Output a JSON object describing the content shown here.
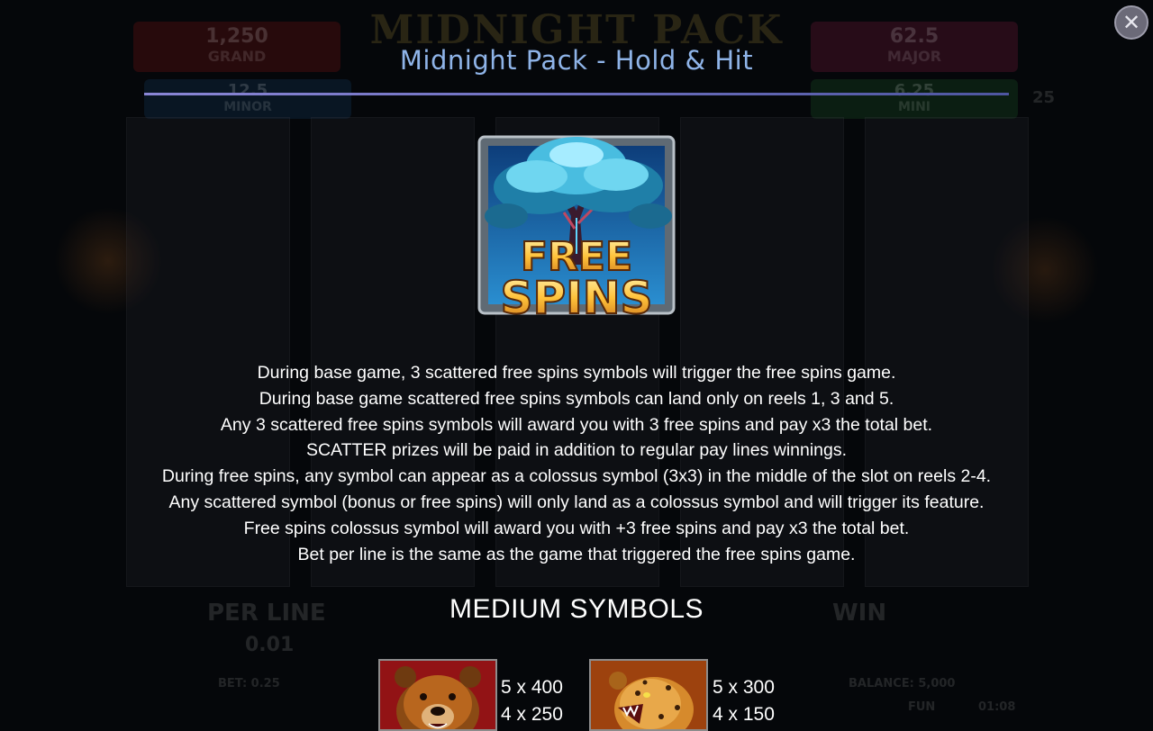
{
  "dialog": {
    "title": "Midnight Pack - Hold & Hit",
    "close_icon": "close-icon"
  },
  "feature_symbol": {
    "icon": "free-spins-symbol",
    "line1": "FREE",
    "line2": "SPINS"
  },
  "description": [
    "During base game, 3 scattered free spins symbols will trigger the free spins game.",
    "During base game scattered free spins symbols can land only on reels 1, 3 and 5.",
    "Any 3 scattered free spins symbols will award you with 3 free spins and pay x3 the total bet.",
    "SCATTER prizes will be paid in addition to regular pay lines winnings.",
    "During free spins, any symbol can appear as a colossus symbol (3x3) in the middle of the slot on reels 2-4.",
    "Any scattered symbol (bonus or free spins) will only land as a colossus symbol and will trigger its feature.",
    "Free spins colossus symbol will award you with +3 free spins and pay x3 the total bet.",
    "Bet per line is the same as the game that triggered the free spins game."
  ],
  "medium_symbols": {
    "heading": "MEDIUM SYMBOLS",
    "items": [
      {
        "icon": "bear-icon",
        "pays": [
          "5 x 400",
          "4 x 250"
        ]
      },
      {
        "icon": "jaguar-icon",
        "pays": [
          "5 x 300",
          "4 x 150"
        ]
      }
    ]
  },
  "background_game": {
    "title": "MIDNIGHT PACK",
    "jackpots": {
      "grand": {
        "value": "1,250",
        "label": "GRAND"
      },
      "major": {
        "value": "62.5",
        "label": "MAJOR"
      },
      "minor": {
        "value": "12.5",
        "label": "MINOR"
      },
      "mini": {
        "value": "6.25",
        "label": "MINI"
      }
    },
    "lines_badge": "25",
    "per_line_label": "PER LINE",
    "per_line_value": "0.01",
    "win_label": "WIN",
    "bet_text": "BET: 0.25",
    "balance_text": "BALANCE: 5,000",
    "mode_text": "FUN",
    "clock_text": "01:08"
  },
  "colors": {
    "title": "#8fb4e8",
    "divider": "#7a78c8",
    "background": "#05070a"
  }
}
